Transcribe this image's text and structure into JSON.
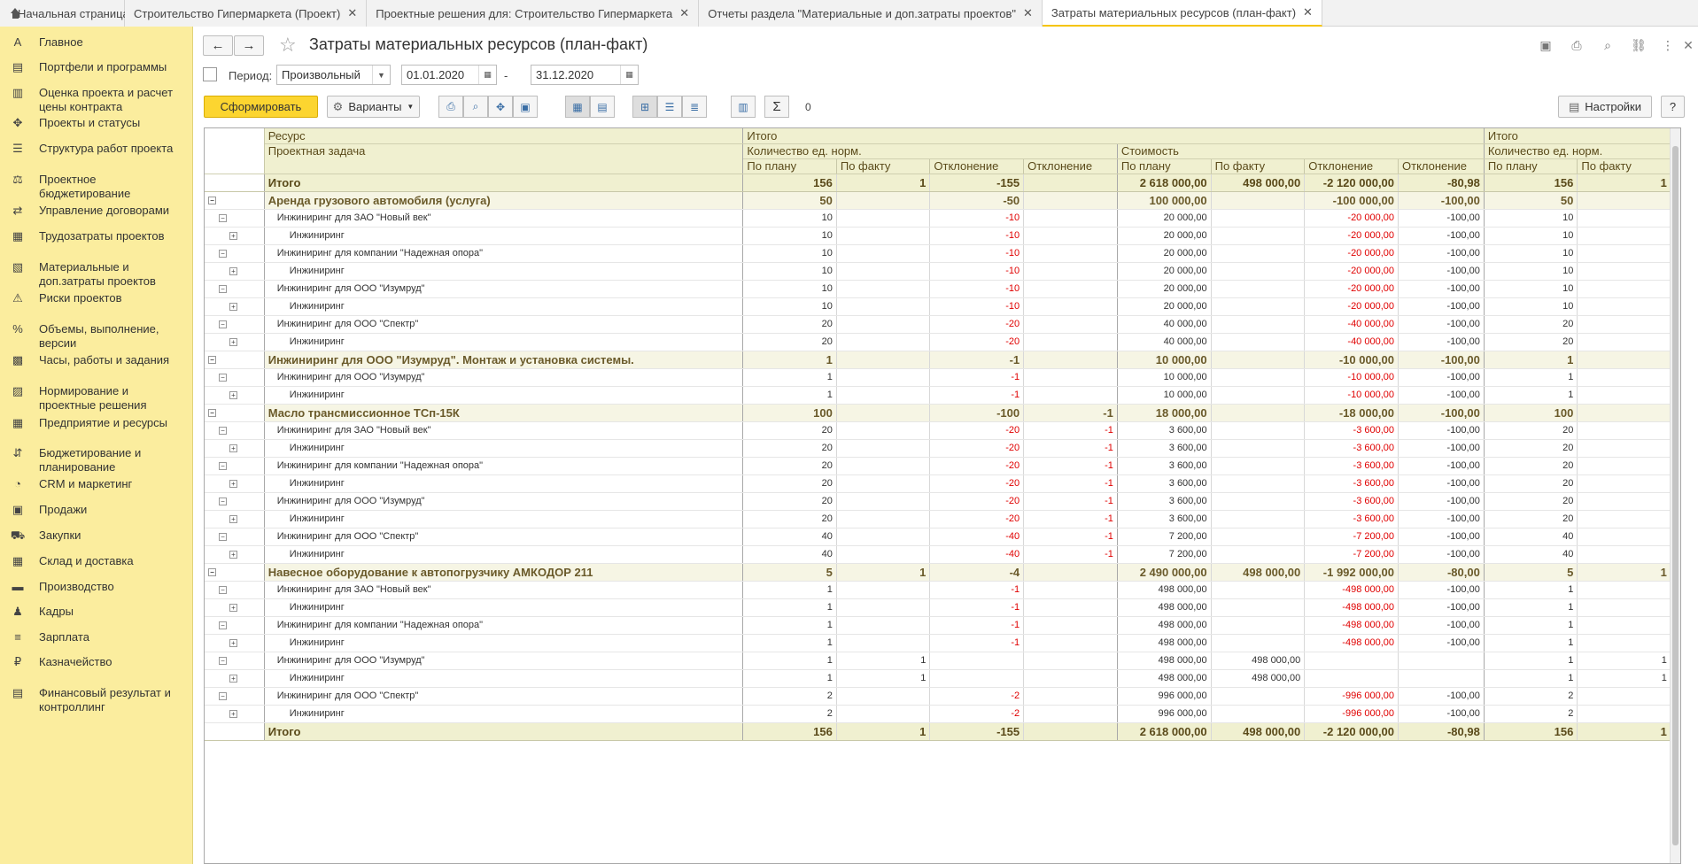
{
  "tabs": [
    {
      "label": "Начальная страница",
      "active": false,
      "closable": false
    },
    {
      "label": "Строительство Гипермаркета (Проект)",
      "active": false,
      "closable": true
    },
    {
      "label": "Проектные решения для: Строительство Гипермаркета",
      "active": false,
      "closable": true
    },
    {
      "label": "Отчеты раздела \"Материальные и доп.затраты проектов\"",
      "active": false,
      "closable": true
    },
    {
      "label": "Затраты материальных ресурсов (план-факт)",
      "active": true,
      "closable": true
    }
  ],
  "sidebar": [
    {
      "label": "Главное",
      "icon": "A"
    },
    {
      "label": "Портфели и программы",
      "icon": "▤"
    },
    {
      "label": "Оценка проекта и расчет цены контракта",
      "icon": "▥"
    },
    {
      "label": "Проекты и статусы",
      "icon": "✥"
    },
    {
      "label": "Структура работ проекта",
      "icon": "☰"
    },
    {
      "label": "Проектное бюджетирование",
      "icon": "⚖"
    },
    {
      "label": "Управление договорами",
      "icon": "⇄"
    },
    {
      "label": "Трудозатраты проектов",
      "icon": "▦"
    },
    {
      "label": "Материальные и доп.затраты проектов",
      "icon": "▧"
    },
    {
      "label": "Риски проектов",
      "icon": "⚠"
    },
    {
      "label": "Объемы, выполнение, версии",
      "icon": "%"
    },
    {
      "label": "Часы, работы и задания",
      "icon": "▩"
    },
    {
      "label": "Нормирование и проектные решения",
      "icon": "▨"
    },
    {
      "label": "Предприятие и ресурсы",
      "icon": "▦"
    },
    {
      "label": "Бюджетирование и планирование",
      "icon": "⇵"
    },
    {
      "label": "CRM и маркетинг",
      "icon": "◔"
    },
    {
      "label": "Продажи",
      "icon": "▣"
    },
    {
      "label": "Закупки",
      "icon": "⛟"
    },
    {
      "label": "Склад и доставка",
      "icon": "▦"
    },
    {
      "label": "Производство",
      "icon": "▬"
    },
    {
      "label": "Кадры",
      "icon": "♟"
    },
    {
      "label": "Зарплата",
      "icon": "≡"
    },
    {
      "label": "Казначейство",
      "icon": "₽"
    },
    {
      "label": "Финансовый результат и контроллинг",
      "icon": "▤"
    }
  ],
  "header": {
    "title": "Затраты материальных ресурсов (план-факт)",
    "back_icon": "←",
    "forward_icon": "→"
  },
  "filter": {
    "period_label": "Период:",
    "period_value": "Произвольный",
    "date_from": "01.01.2020",
    "date_sep": "-",
    "date_to": "31.12.2020"
  },
  "toolbar": {
    "generate_label": "Сформировать",
    "variants_label": "Варианты",
    "sum_value": "0",
    "settings_label": "Настройки",
    "help_label": "?"
  },
  "report": {
    "hdr": {
      "resource": "Ресурс",
      "task": "Проектная задача",
      "total": "Итого",
      "qty": "Количество ед. норм.",
      "cost": "Стоимость",
      "plan": "По плану",
      "fact": "По факту",
      "dev": "Отклонение"
    },
    "rows": [
      {
        "kind": "tot",
        "label": "Итого",
        "v": [
          "156",
          "1",
          "-155",
          "",
          "2 618 000,00",
          "498 000,00",
          "-2 120 000,00",
          "-80,98",
          "156",
          "1"
        ]
      },
      {
        "kind": "grp",
        "label": "Аренда грузового автомобиля (услуга)",
        "v": [
          "50",
          "",
          "-50",
          "",
          "100 000,00",
          "",
          "-100 000,00",
          "-100,00",
          "50",
          ""
        ]
      },
      {
        "kind": "l1",
        "label": "Инжиниринг для ЗАО \"Новый век\"",
        "v": [
          "10",
          "",
          "-10",
          "",
          "20 000,00",
          "",
          "-20 000,00",
          "-100,00",
          "10",
          ""
        ]
      },
      {
        "kind": "l2",
        "label": "Инжиниринг",
        "v": [
          "10",
          "",
          "-10",
          "",
          "20 000,00",
          "",
          "-20 000,00",
          "-100,00",
          "10",
          ""
        ]
      },
      {
        "kind": "l1",
        "label": "Инжиниринг для компании \"Надежная опора\"",
        "v": [
          "10",
          "",
          "-10",
          "",
          "20 000,00",
          "",
          "-20 000,00",
          "-100,00",
          "10",
          ""
        ]
      },
      {
        "kind": "l2",
        "label": "Инжиниринг",
        "v": [
          "10",
          "",
          "-10",
          "",
          "20 000,00",
          "",
          "-20 000,00",
          "-100,00",
          "10",
          ""
        ]
      },
      {
        "kind": "l1",
        "label": "Инжиниринг для ООО \"Изумруд\"",
        "v": [
          "10",
          "",
          "-10",
          "",
          "20 000,00",
          "",
          "-20 000,00",
          "-100,00",
          "10",
          ""
        ]
      },
      {
        "kind": "l2",
        "label": "Инжиниринг",
        "v": [
          "10",
          "",
          "-10",
          "",
          "20 000,00",
          "",
          "-20 000,00",
          "-100,00",
          "10",
          ""
        ]
      },
      {
        "kind": "l1",
        "label": "Инжиниринг для ООО \"Спектр\"",
        "v": [
          "20",
          "",
          "-20",
          "",
          "40 000,00",
          "",
          "-40 000,00",
          "-100,00",
          "20",
          ""
        ]
      },
      {
        "kind": "l2",
        "label": "Инжиниринг",
        "v": [
          "20",
          "",
          "-20",
          "",
          "40 000,00",
          "",
          "-40 000,00",
          "-100,00",
          "20",
          ""
        ]
      },
      {
        "kind": "grp",
        "label": "Инжиниринг для ООО \"Изумруд\". Монтаж и установка системы.",
        "v": [
          "1",
          "",
          "-1",
          "",
          "10 000,00",
          "",
          "-10 000,00",
          "-100,00",
          "1",
          ""
        ]
      },
      {
        "kind": "l1",
        "label": "Инжиниринг для ООО \"Изумруд\"",
        "v": [
          "1",
          "",
          "-1",
          "",
          "10 000,00",
          "",
          "-10 000,00",
          "-100,00",
          "1",
          ""
        ]
      },
      {
        "kind": "l2",
        "label": "Инжиниринг",
        "v": [
          "1",
          "",
          "-1",
          "",
          "10 000,00",
          "",
          "-10 000,00",
          "-100,00",
          "1",
          ""
        ]
      },
      {
        "kind": "grp",
        "label": "Масло трансмиссионное ТСп-15К",
        "v": [
          "100",
          "",
          "-100",
          "-1",
          "18 000,00",
          "",
          "-18 000,00",
          "-100,00",
          "100",
          ""
        ]
      },
      {
        "kind": "l1",
        "label": "Инжиниринг для ЗАО \"Новый век\"",
        "v": [
          "20",
          "",
          "-20",
          "-1",
          "3 600,00",
          "",
          "-3 600,00",
          "-100,00",
          "20",
          ""
        ]
      },
      {
        "kind": "l2",
        "label": "Инжиниринг",
        "v": [
          "20",
          "",
          "-20",
          "-1",
          "3 600,00",
          "",
          "-3 600,00",
          "-100,00",
          "20",
          ""
        ]
      },
      {
        "kind": "l1",
        "label": "Инжиниринг для компании \"Надежная опора\"",
        "v": [
          "20",
          "",
          "-20",
          "-1",
          "3 600,00",
          "",
          "-3 600,00",
          "-100,00",
          "20",
          ""
        ]
      },
      {
        "kind": "l2",
        "label": "Инжиниринг",
        "v": [
          "20",
          "",
          "-20",
          "-1",
          "3 600,00",
          "",
          "-3 600,00",
          "-100,00",
          "20",
          ""
        ]
      },
      {
        "kind": "l1",
        "label": "Инжиниринг для ООО \"Изумруд\"",
        "v": [
          "20",
          "",
          "-20",
          "-1",
          "3 600,00",
          "",
          "-3 600,00",
          "-100,00",
          "20",
          ""
        ]
      },
      {
        "kind": "l2",
        "label": "Инжиниринг",
        "v": [
          "20",
          "",
          "-20",
          "-1",
          "3 600,00",
          "",
          "-3 600,00",
          "-100,00",
          "20",
          ""
        ]
      },
      {
        "kind": "l1",
        "label": "Инжиниринг для ООО \"Спектр\"",
        "v": [
          "40",
          "",
          "-40",
          "-1",
          "7 200,00",
          "",
          "-7 200,00",
          "-100,00",
          "40",
          ""
        ]
      },
      {
        "kind": "l2",
        "label": "Инжиниринг",
        "v": [
          "40",
          "",
          "-40",
          "-1",
          "7 200,00",
          "",
          "-7 200,00",
          "-100,00",
          "40",
          ""
        ]
      },
      {
        "kind": "grp",
        "label": "Навесное оборудование к автопогрузчику АМКОДОР 211",
        "v": [
          "5",
          "1",
          "-4",
          "",
          "2 490 000,00",
          "498 000,00",
          "-1 992 000,00",
          "-80,00",
          "5",
          "1"
        ]
      },
      {
        "kind": "l1",
        "label": "Инжиниринг для ЗАО \"Новый век\"",
        "v": [
          "1",
          "",
          "-1",
          "",
          "498 000,00",
          "",
          "-498 000,00",
          "-100,00",
          "1",
          ""
        ]
      },
      {
        "kind": "l2",
        "label": "Инжиниринг",
        "v": [
          "1",
          "",
          "-1",
          "",
          "498 000,00",
          "",
          "-498 000,00",
          "-100,00",
          "1",
          ""
        ]
      },
      {
        "kind": "l1",
        "label": "Инжиниринг для компании \"Надежная опора\"",
        "v": [
          "1",
          "",
          "-1",
          "",
          "498 000,00",
          "",
          "-498 000,00",
          "-100,00",
          "1",
          ""
        ]
      },
      {
        "kind": "l2",
        "label": "Инжиниринг",
        "v": [
          "1",
          "",
          "-1",
          "",
          "498 000,00",
          "",
          "-498 000,00",
          "-100,00",
          "1",
          ""
        ]
      },
      {
        "kind": "l1",
        "label": "Инжиниринг для ООО \"Изумруд\"",
        "v": [
          "1",
          "1",
          "",
          "",
          "498 000,00",
          "498 000,00",
          "",
          "",
          "1",
          "1"
        ]
      },
      {
        "kind": "l2",
        "label": "Инжиниринг",
        "v": [
          "1",
          "1",
          "",
          "",
          "498 000,00",
          "498 000,00",
          "",
          "",
          "1",
          "1"
        ]
      },
      {
        "kind": "l1",
        "label": "Инжиниринг для ООО \"Спектр\"",
        "v": [
          "2",
          "",
          "-2",
          "",
          "996 000,00",
          "",
          "-996 000,00",
          "-100,00",
          "2",
          ""
        ]
      },
      {
        "kind": "l2",
        "label": "Инжиниринг",
        "v": [
          "2",
          "",
          "-2",
          "",
          "996 000,00",
          "",
          "-996 000,00",
          "-100,00",
          "2",
          ""
        ]
      },
      {
        "kind": "tot",
        "label": "Итого",
        "v": [
          "156",
          "1",
          "-155",
          "",
          "2 618 000,00",
          "498 000,00",
          "-2 120 000,00",
          "-80,98",
          "156",
          "1"
        ]
      }
    ]
  }
}
